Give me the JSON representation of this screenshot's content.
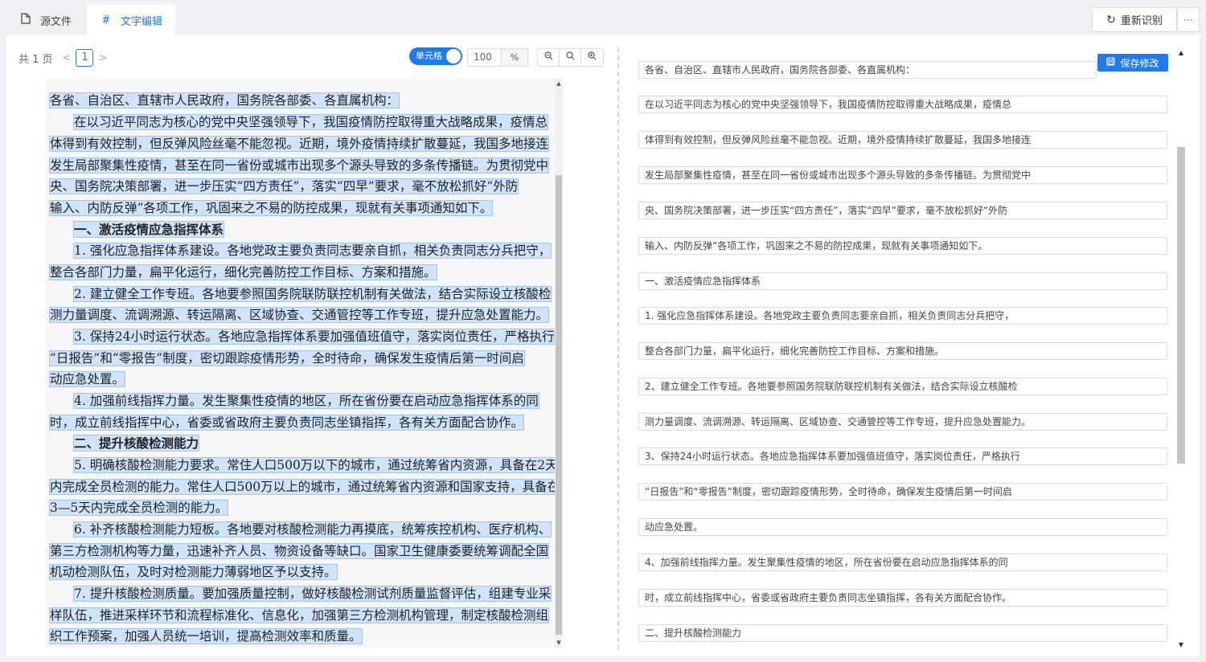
{
  "tabs": [
    {
      "label": "源文件",
      "icon": "file-icon"
    },
    {
      "label": "文字编辑",
      "icon": "hash-icon"
    }
  ],
  "toolbar": {
    "reocr_label": "重新识别",
    "more_label": "···",
    "page_total": "共 1 页",
    "page_current": "1",
    "cell_toggle_label": "单元格",
    "zoom_value": "100",
    "zoom_unit": "%",
    "save_label": "保存修改"
  },
  "document_lines": [
    "各省、自治区、直辖市人民政府，国务院各部委、各直属机构：",
    "在以习近平同志为核心的党中央坚强领导下，我国疫情防控取得重大战略成果，疫情总",
    "体得到有效控制，但反弹风险丝毫不能忽视。近期，境外疫情持续扩散蔓延，我国多地接连",
    "发生局部聚集性疫情，甚至在同一省份或城市出现多个源头导致的多条传播链。为贯彻党中",
    "央、国务院决策部署，进一步压实“四方责任”，落实“四早”要求，毫不放松抓好“外防",
    "输入、内防反弹”各项工作，巩固来之不易的防控成果，现就有关事项通知如下。",
    "一、激活疫情应急指挥体系",
    "1. 强化应急指挥体系建设。各地党政主要负责同志要亲自抓，相关负责同志分兵把守，",
    "整合各部门力量，扁平化运行，细化完善防控工作目标、方案和措施。",
    "2. 建立健全工作专班。各地要参照国务院联防联控机制有关做法，结合实际设立核酸检",
    "测力量调度、流调溯源、转运隔离、区域协查、交通管控等工作专班，提升应急处置能力。",
    "3. 保持24小时运行状态。各地应急指挥体系要加强值班值守，落实岗位责任，严格执行",
    "“日报告”和“零报告”制度，密切跟踪疫情形势，全时待命，确保发生疫情后第一时间启",
    "动应急处置。",
    "4. 加强前线指挥力量。发生聚集性疫情的地区，所在省份要在启动应急指挥体系的同",
    "时，成立前线指挥中心，省委或省政府主要负责同志坐镇指挥，各有关方面配合协作。",
    "二、提升核酸检测能力",
    "5. 明确核酸检测能力要求。常住人口500万以下的城市，通过统筹省内资源，具备在2天",
    "内完成全员检测的能力。常住人口500万以上的城市，通过统筹省内资源和国家支持，具备在",
    "3—5天内完成全员检测的能力。",
    "6. 补齐核酸检测能力短板。各地要对核酸检测能力再摸底，统筹疾控机构、医疗机构、",
    "第三方检测机构等力量，迅速补齐人员、物资设备等缺口。国家卫生健康委要统筹调配全国",
    "机动检测队伍，及时对检测能力薄弱地区予以支持。",
    "7. 提升核酸检测质量。要加强质量控制，做好核酸检测试剂质量监督评估，组建专业采",
    "样队伍，推进采样环节和流程标准化、信息化，加强第三方检测机构管理，制定核酸检测组",
    "织工作预案，加强人员统一培训，提高检测效率和质量。"
  ],
  "edit_fields": [
    "各省、自治区、直辖市人民政府，国务院各部委、各直属机构：",
    "在以习近平同志为核心的党中央坚强领导下，我国疫情防控取得重大战略成果，疫情总",
    "体得到有效控制，但反弹风险丝毫不能忽视。近期，境外疫情持续扩散蔓延，我国多地接连",
    "发生局部聚集性疫情，甚至在同一省份或城市出现多个源头导致的多条传播链。为贯彻党中",
    "央、国务院决策部署，进一步压实“四方责任”，落实“四早”要求，毫不放松抓好“外防",
    "输入、内防反弹”各项工作，巩固来之不易的防控成果，现就有关事项通知如下。",
    "一、激活疫情应急指挥体系",
    "1. 强化应急指挥体系建设。各地党政主要负责同志要亲自抓，相关负责同志分兵把守，",
    "整合各部门力量，扁平化运行，细化完善防控工作目标、方案和措施。",
    "2、建立健全工作专班。各地要参照国务院联防联控机制有关做法，结合实际设立核酸检",
    "测力量调度、流调溯源、转运隔离、区域协查、交通管控等工作专班，提升应急处置能力。",
    "3、保持24小时运行状态。各地应急指挥体系要加强值班值守，落实岗位责任，严格执行",
    "“日报告”和“零报告”制度，密切跟踪疫情形势，全时待命，确保发生疫情后第一时间启",
    "动应急处置。",
    "4、加强前线指挥力量。发生聚集性疫情的地区，所在省份要在启动应急指挥体系的同",
    "时，成立前线指挥中心，省委或省政府主要负责同志坐镇指挥，各有关方面配合协作。",
    "二、提升核酸检测能力"
  ]
}
